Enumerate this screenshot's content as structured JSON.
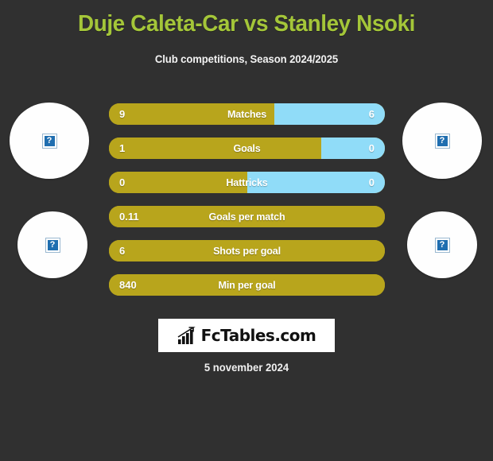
{
  "header": {
    "title": "Duje Caleta-Car vs Stanley Nsoki",
    "subtitle": "Club competitions, Season 2024/2025",
    "title_color": "#a4c639"
  },
  "colors": {
    "background": "#303030",
    "home_bar": "#b8a51c",
    "away_bar": "#90dcf8",
    "text": "#ffffff"
  },
  "avatars": [
    {
      "name": "home-player-photo-top",
      "placeholder": "?"
    },
    {
      "name": "away-player-photo-top",
      "placeholder": "?"
    },
    {
      "name": "home-player-photo-bottom",
      "placeholder": "?"
    },
    {
      "name": "away-player-photo-bottom",
      "placeholder": "?"
    }
  ],
  "chart_data": {
    "type": "bar",
    "title": "Duje Caleta-Car vs Stanley Nsoki",
    "subtitle": "Club competitions, Season 2024/2025",
    "orientation": "horizontal-diverging",
    "series": [
      {
        "name": "Duje Caleta-Car",
        "color": "#b8a51c"
      },
      {
        "name": "Stanley Nsoki",
        "color": "#90dcf8"
      }
    ],
    "categories": [
      "Matches",
      "Goals",
      "Hattricks",
      "Goals per match",
      "Shots per goal",
      "Min per goal"
    ],
    "rows": [
      {
        "label": "Matches",
        "home": "9",
        "away": "6",
        "home_pct": 60,
        "away_pct": 40
      },
      {
        "label": "Goals",
        "home": "1",
        "away": "0",
        "home_pct": 77,
        "away_pct": 23
      },
      {
        "label": "Hattricks",
        "home": "0",
        "away": "0",
        "home_pct": 50,
        "away_pct": 50
      },
      {
        "label": "Goals per match",
        "home": "0.11",
        "away": "",
        "home_pct": 100,
        "away_pct": 0
      },
      {
        "label": "Shots per goal",
        "home": "6",
        "away": "",
        "home_pct": 100,
        "away_pct": 0
      },
      {
        "label": "Min per goal",
        "home": "840",
        "away": "",
        "home_pct": 100,
        "away_pct": 0
      }
    ]
  },
  "logo": {
    "text": "FcTables.com",
    "icon": "bar-chart-growth-icon"
  },
  "footer": {
    "date": "5 november 2024"
  }
}
